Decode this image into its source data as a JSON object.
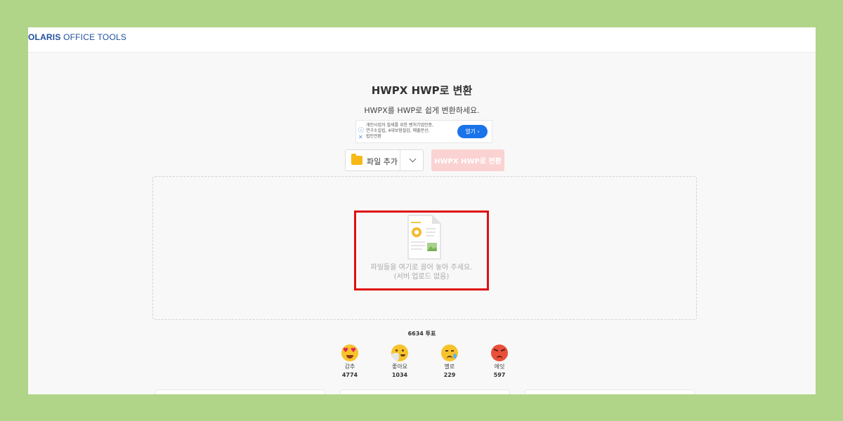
{
  "header": {
    "logo_bold": "OLARIS",
    "logo_rest": " OFFICE TOOLS"
  },
  "main": {
    "title": "HWPX HWP로 변환",
    "subtitle": "HWPX를 HWP로 쉽게 변환하세요.",
    "add_file_label": "파일 추가",
    "convert_label": "HWPX HWP로 변환",
    "drop_text_1": "파일들을 여기로 끌어 놓아 주세요.",
    "drop_text_2": "(서버 업로드 없음)"
  },
  "ad": {
    "line1": "개인사업자 절세를 위한 벤처기업인증,",
    "line2": "연구소설립, 4대보험절감, 매출분산,",
    "line3": "법인전환",
    "button_label": "열기 ›"
  },
  "votes": {
    "total_label": "6634 투표",
    "reactions": [
      {
        "label": "감추",
        "count": "4774",
        "icon": "heart-eyes-emoji"
      },
      {
        "label": "좋아요",
        "count": "1034",
        "icon": "thumbs-up-emoji"
      },
      {
        "label": "별로",
        "count": "229",
        "icon": "sad-tear-emoji"
      },
      {
        "label": "에잇",
        "count": "597",
        "icon": "angry-emoji"
      }
    ]
  },
  "colors": {
    "background": "#b0d488",
    "highlight": "#e01010",
    "convert_button": "#fbd2d2",
    "ad_button": "#1a73e8",
    "logo": "#1f4e9c"
  }
}
